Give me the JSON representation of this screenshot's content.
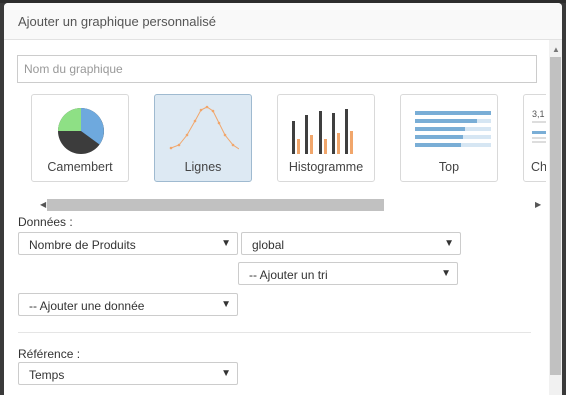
{
  "dialog": {
    "title": "Ajouter un graphique personnalisé"
  },
  "name_field": {
    "placeholder": "Nom du graphique",
    "value": ""
  },
  "chart_types": [
    {
      "label": "Camembert",
      "icon": "pie-chart-icon",
      "selected": false
    },
    {
      "label": "Lignes",
      "icon": "line-chart-icon",
      "selected": true
    },
    {
      "label": "Histogramme",
      "icon": "bar-chart-icon",
      "selected": false
    },
    {
      "label": "Top",
      "icon": "top-list-icon",
      "selected": false
    },
    {
      "label": "Ch",
      "icon": "stat-icon",
      "selected": false
    }
  ],
  "colors": {
    "pie_blue": "#6ea9de",
    "pie_green": "#8ee085",
    "pie_dark": "#3c3c3c",
    "line_orange": "#f1a66b",
    "bar_dark": "#3f3f3f",
    "bar_orange": "#f1a66b",
    "top_blue": "#7aaed6",
    "selected_bg": "#dde9f3"
  },
  "data_section": {
    "label": "Données :",
    "measure": "Nombre de Produits",
    "scope": "global",
    "sort_placeholder": "-- Ajouter un tri",
    "add_data": "-- Ajouter une donnée"
  },
  "reference_section": {
    "label": "Référence :",
    "value": "Temps"
  },
  "partial_card_text": {
    "value": "3,1"
  }
}
